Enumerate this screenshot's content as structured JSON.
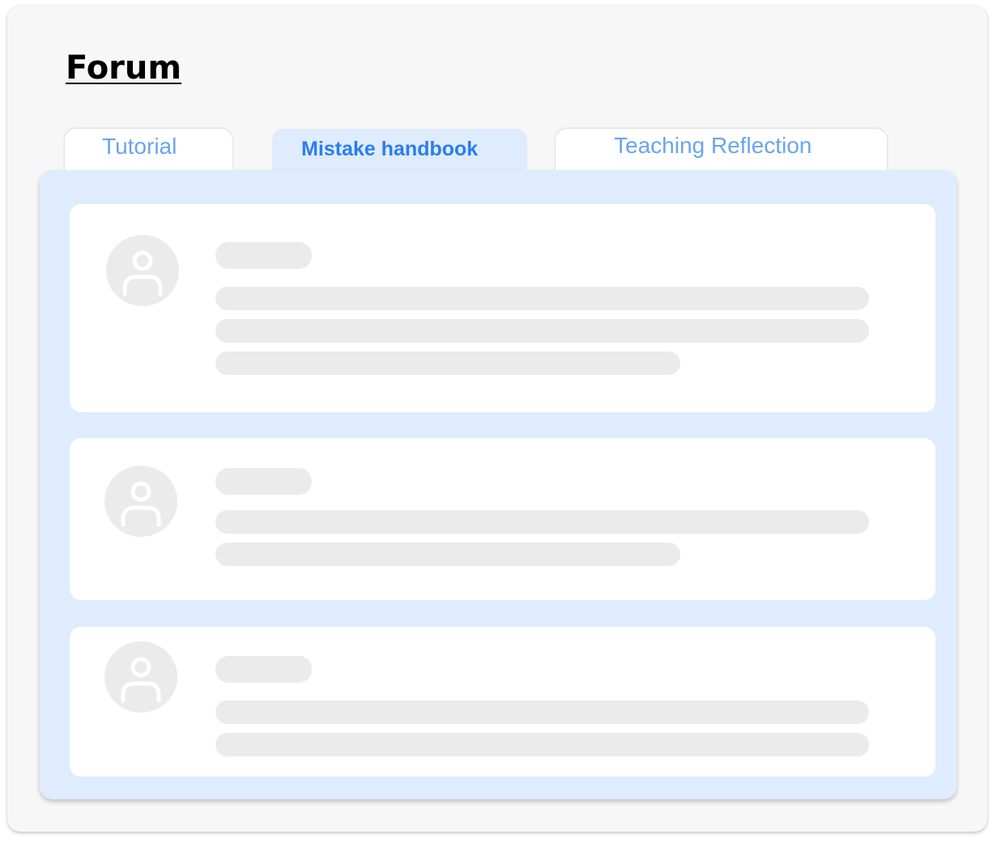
{
  "page": {
    "title": "Forum"
  },
  "tabs": [
    {
      "label": "Tutorial",
      "active": false
    },
    {
      "label": "Mistake handbook",
      "active": true
    },
    {
      "label": "Teaching Reflection",
      "active": false
    }
  ],
  "posts": [
    {
      "avatar_icon": "user-icon",
      "line_count": 3
    },
    {
      "avatar_icon": "user-icon",
      "line_count": 2
    },
    {
      "avatar_icon": "user-icon",
      "line_count": 2
    }
  ],
  "colors": {
    "accent": "#2b7df0",
    "tab_inactive_text": "#6aa4ef",
    "panel_background": "#dfecfd",
    "placeholder": "#ebebeb",
    "avatar_glyph": "#ffffff"
  }
}
